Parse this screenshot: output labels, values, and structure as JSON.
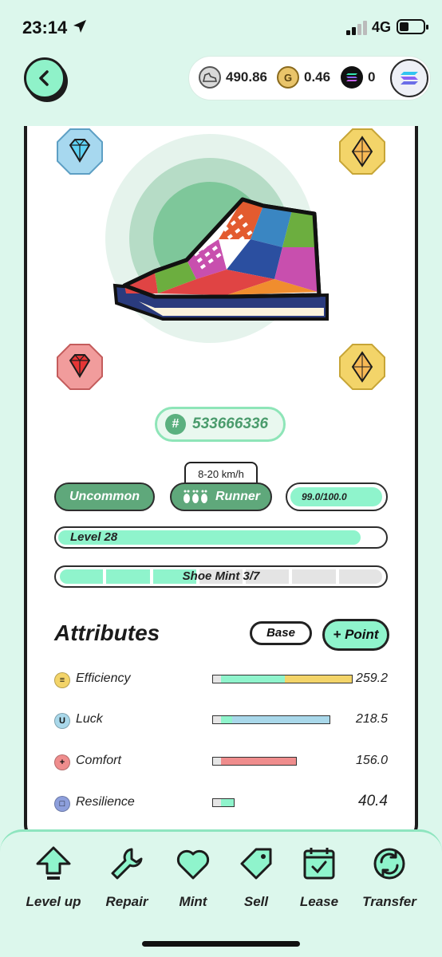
{
  "status_bar": {
    "time": "23:14",
    "network": "4G",
    "icons": [
      "location-arrow-icon",
      "signal-icon",
      "battery-icon"
    ]
  },
  "header": {
    "back_icon": "chevron-left-icon",
    "balances": [
      {
        "icon": "sneaker-token-icon",
        "value": "490.86"
      },
      {
        "icon": "gmt-coin-icon",
        "value": "0.46"
      },
      {
        "icon": "solana-icon",
        "value": "0"
      }
    ],
    "chain_icon": "solana-icon"
  },
  "shoe": {
    "id": "533666336",
    "id_prefix": "#",
    "speed_range": "8-20 km/h",
    "rarity": "Uncommon",
    "type": "Runner",
    "durability": "99.0/100.0",
    "durability_fraction": 0.99,
    "level_label": "Level 28",
    "level_fraction": 0.93,
    "mint_label": "Shoe Mint 3/7",
    "mint_count": 3,
    "mint_total": 7,
    "gems": [
      "diamond-gem-icon",
      "topaz-gem-icon",
      "ruby-gem-icon",
      "topaz-gem-icon"
    ]
  },
  "attributes": {
    "title": "Attributes",
    "base_label": "Base",
    "point_label": "+ Point",
    "items": [
      {
        "name": "Efficiency",
        "value": "259.2",
        "icon": "efficiency-icon",
        "glyph": "≡",
        "color": "#f3d469"
      },
      {
        "name": "Luck",
        "value": "218.5",
        "icon": "luck-icon",
        "glyph": "U",
        "color": "#a9d8ea"
      },
      {
        "name": "Comfort",
        "value": "156.0",
        "icon": "comfort-icon",
        "glyph": "+",
        "color": "#ef8d8d"
      },
      {
        "name": "Resilience",
        "value": "40.4",
        "icon": "resilience-icon",
        "glyph": "□",
        "color": "#8d9fdc"
      }
    ]
  },
  "actions": [
    {
      "label": "Level up",
      "icon": "level-up-icon"
    },
    {
      "label": "Repair",
      "icon": "wrench-icon"
    },
    {
      "label": "Mint",
      "icon": "heart-icon"
    },
    {
      "label": "Sell",
      "icon": "price-tag-icon"
    },
    {
      "label": "Lease",
      "icon": "calendar-check-icon"
    },
    {
      "label": "Transfer",
      "icon": "transfer-icon"
    }
  ],
  "colors": {
    "accent": "#8ff4cc",
    "tag_green": "#5fa87b",
    "background": "#dcf7ec"
  }
}
